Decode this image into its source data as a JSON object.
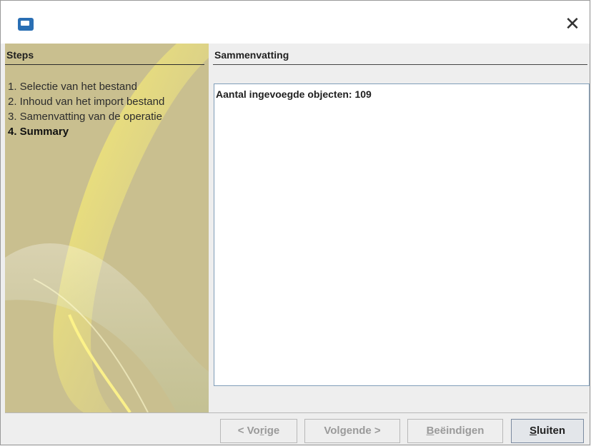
{
  "window": {
    "close_symbol": "✕"
  },
  "sidebar": {
    "title": "Steps",
    "steps": [
      {
        "label": "1. Selectie van het bestand"
      },
      {
        "label": "2. Inhoud van het import bestand"
      },
      {
        "label": "3. Samenvatting van de operatie"
      },
      {
        "label": "4. Summary",
        "active": true
      }
    ]
  },
  "content": {
    "title": "Sammenvatting",
    "summary_text": "Aantal ingevoegde objecten: 109"
  },
  "buttons": {
    "prev": {
      "pre": "< Vo",
      "u": "r",
      "post": "ige"
    },
    "next": {
      "pre": "Vol",
      "u": "g",
      "post": "ende >"
    },
    "finish": {
      "pre": "",
      "u": "B",
      "post": "eëindigen"
    },
    "close": {
      "pre": "",
      "u": "S",
      "post": "luiten"
    }
  },
  "colors": {
    "sidebar_bg": "#c9bf8f",
    "sidebar_swirl": "#fff36a",
    "text_box_border": "#7f9db9"
  },
  "icons": {
    "app": "app-icon",
    "close": "close-icon"
  }
}
